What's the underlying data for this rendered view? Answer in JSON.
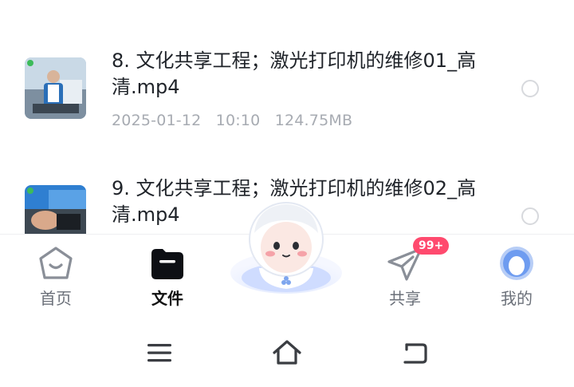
{
  "files": [
    {
      "name": "8. 文化共享工程；激光打印机的维修01_高清.mp4",
      "date": "2025-01-12",
      "time": "10:10",
      "size": "124.75MB",
      "thumb_icon": "video-thumbnail"
    },
    {
      "name": "9. 文化共享工程；激光打印机的维修02_高清.mp4",
      "thumb_icon": "video-thumbnail"
    }
  ],
  "tabbar": {
    "tabs": [
      {
        "label": "首页",
        "icon": "home-icon"
      },
      {
        "label": "文件",
        "icon": "folder-icon",
        "active": true
      },
      {
        "label": "共享",
        "icon": "paper-plane-icon",
        "badge": "99+"
      },
      {
        "label": "我的",
        "icon": "avatar-icon"
      }
    ],
    "center_icon": "mascot-icon"
  },
  "system_nav": [
    "menu-icon",
    "home-outline-icon",
    "back-icon"
  ],
  "colors": {
    "text": "#1f2329",
    "meta": "#a7abb2",
    "badge": "#ff4a6e",
    "active_tab": "#111111",
    "inactive_tab": "#6b7079"
  }
}
